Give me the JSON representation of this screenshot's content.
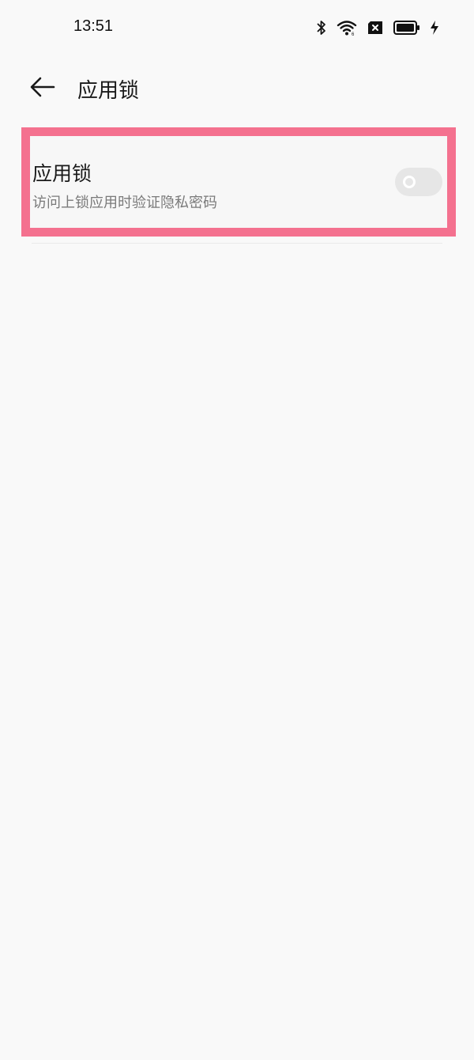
{
  "status_bar": {
    "time": "13:51",
    "icons": [
      "bluetooth-icon",
      "wifi-icon",
      "sim-disabled-icon",
      "battery-icon",
      "charging-icon"
    ]
  },
  "header": {
    "back_icon": "arrow-left-icon",
    "title": "应用锁"
  },
  "settings": [
    {
      "title": "应用锁",
      "description": "访问上锁应用时验证隐私密码",
      "toggle_on": false
    }
  ],
  "colors": {
    "highlight_border": "#f4718f",
    "toggle_off_track": "#e6e6e6",
    "background": "#f9f9f9"
  }
}
